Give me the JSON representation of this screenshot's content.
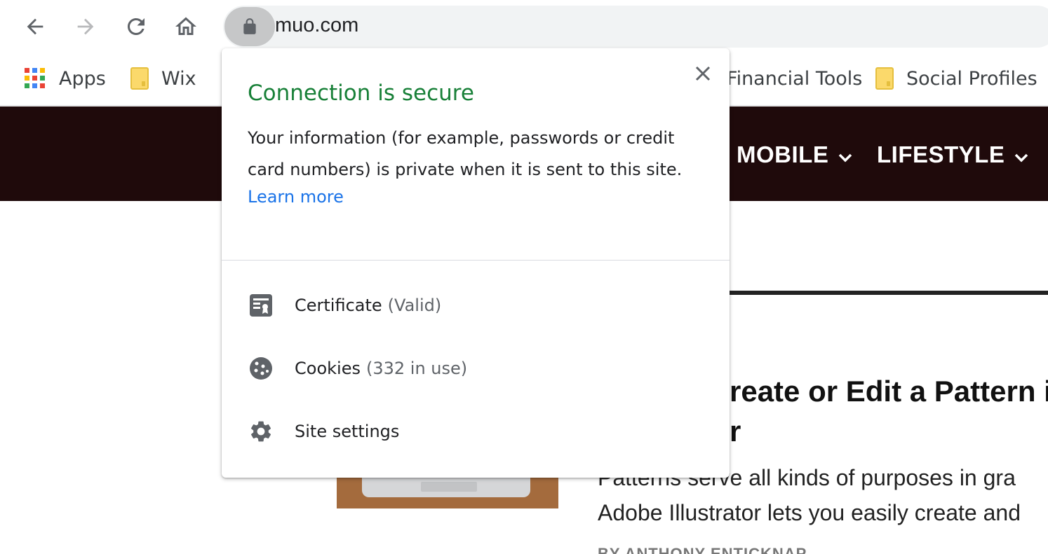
{
  "browser": {
    "url": "muo.com",
    "icons": {
      "back": "back-arrow-icon",
      "forward": "forward-arrow-icon",
      "reload": "reload-icon",
      "home": "home-icon",
      "lock": "lock-icon"
    }
  },
  "bookmarks": {
    "items": [
      {
        "label": "Apps",
        "icon": "apps-grid-icon"
      },
      {
        "label": "Wix",
        "icon": "folder-icon"
      },
      {
        "label": "Financial Tools",
        "icon": "folder-icon"
      },
      {
        "label": "Social Profiles",
        "icon": "folder-icon"
      }
    ]
  },
  "site": {
    "nav": [
      {
        "label": "MOBILE"
      },
      {
        "label": "LIFESTYLE"
      }
    ],
    "article": {
      "headline_visible": "reate or Edit a Pattern i",
      "headline_line2_visible": "r",
      "excerpt_line1": "Patterns serve all kinds of purposes in gra",
      "excerpt_line2": "Adobe Illustrator lets you easily create and",
      "byline": "BY ANTHONY ENTICKNAP"
    }
  },
  "popup": {
    "title": "Connection is secure",
    "description": "Your information (for example, passwords or credit card numbers) is private when it is sent to this site.",
    "learn_more": "Learn more",
    "rows": [
      {
        "label": "Certificate",
        "sub": "(Valid)",
        "icon": "certificate-icon"
      },
      {
        "label": "Cookies",
        "sub": "(332 in use)",
        "icon": "cookie-icon"
      },
      {
        "label": "Site settings",
        "sub": "",
        "icon": "gear-icon"
      }
    ],
    "colors": {
      "secure_green": "#188038",
      "link_blue": "#1a73e8"
    }
  },
  "colors": {
    "site_nav_bg": "#1f0a0b"
  }
}
